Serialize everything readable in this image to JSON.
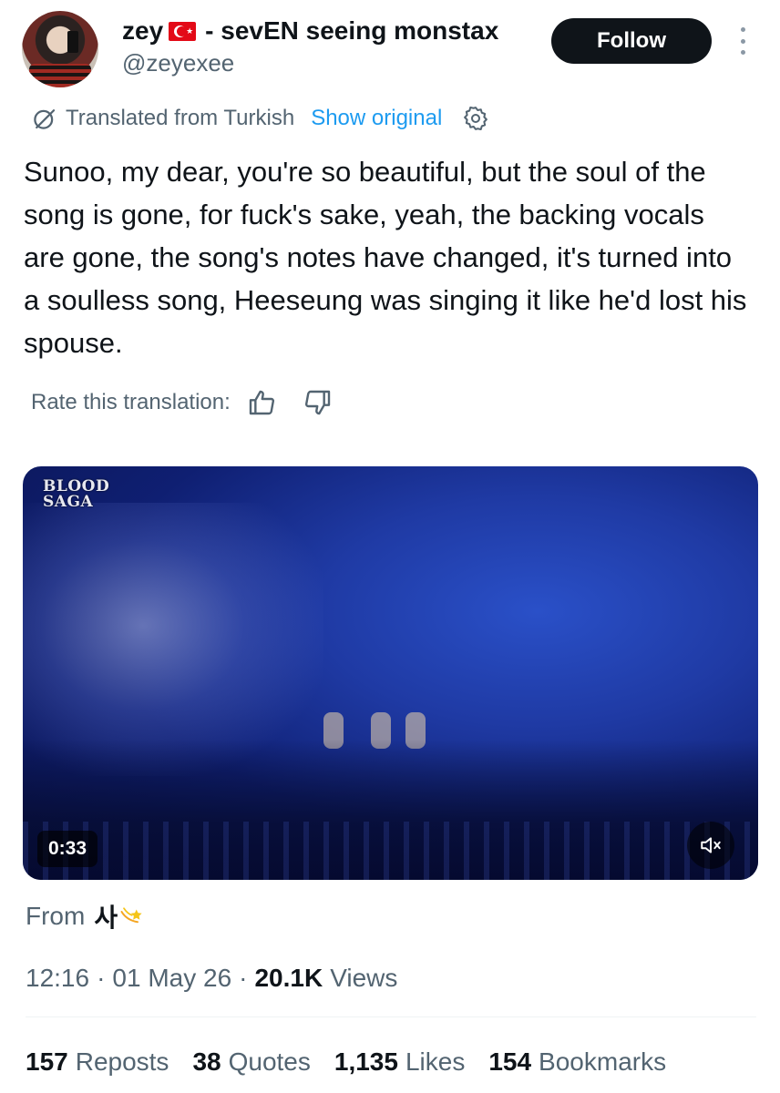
{
  "author": {
    "display_name": "zey",
    "flag": "turkey-flag",
    "display_name_suffix": " - sevEN seeing monstax",
    "handle": "@zeyexee"
  },
  "follow_button": {
    "label": "Follow"
  },
  "translation": {
    "translated_from": "Translated from Turkish",
    "show_original": "Show original"
  },
  "tweet": {
    "text": "Sunoo, my dear, you're so beautiful, but the soul of the song is gone, for fuck's sake, yeah, the backing vocals are gone, the song's notes have changed, it's turned into a soulless song, Heeseung was singing it like he'd lost his spouse."
  },
  "rating": {
    "label": "Rate this translation:"
  },
  "video": {
    "logo_line1": "BLOOD",
    "logo_line2": "SAGA",
    "duration": "0:33"
  },
  "source": {
    "from_label": "From",
    "from_name": "사"
  },
  "meta": {
    "time": "12:16",
    "date": "01 May 26",
    "views_count": "20.1K",
    "views_label": "Views"
  },
  "stats": {
    "reposts_count": "157",
    "reposts_label": "Reposts",
    "quotes_count": "38",
    "quotes_label": "Quotes",
    "likes_count": "1,135",
    "likes_label": "Likes",
    "bookmarks_count": "154",
    "bookmarks_label": "Bookmarks"
  },
  "colors": {
    "text_primary": "#0f1419",
    "text_secondary": "#536471",
    "link": "#1d9bf0",
    "follow_bg": "#0f1419"
  }
}
